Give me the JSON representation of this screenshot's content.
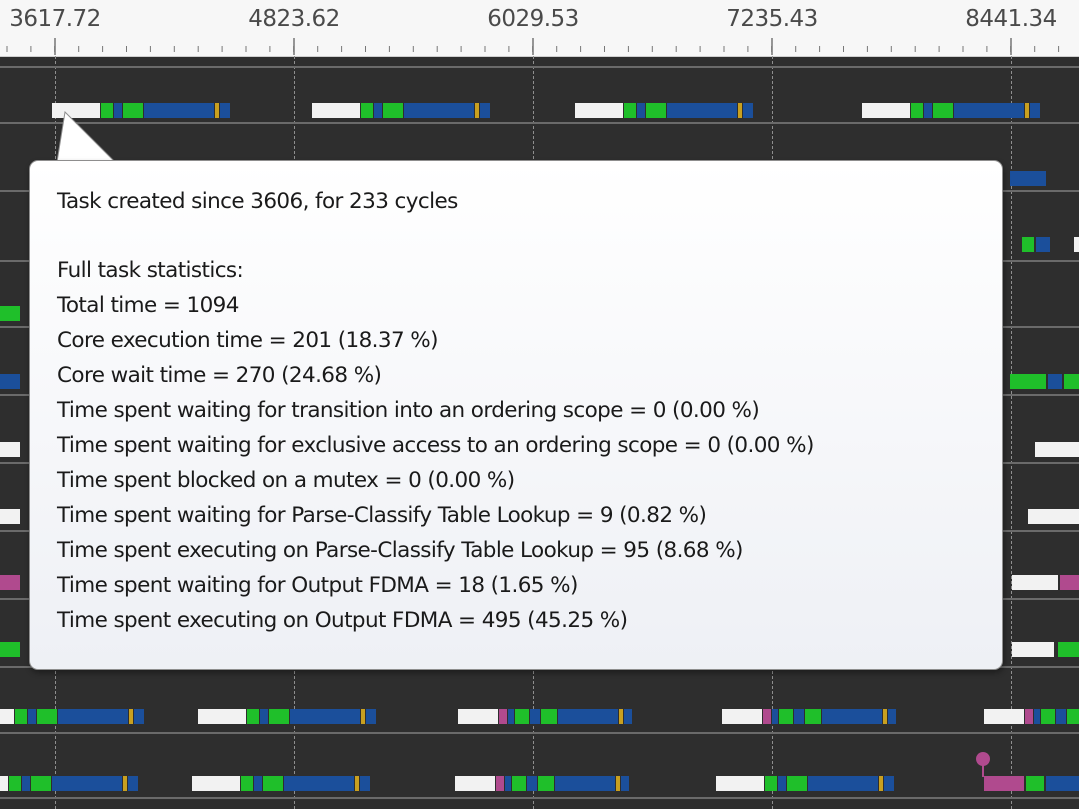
{
  "ruler": {
    "labels": [
      "3617.72",
      "4823.62",
      "6029.53",
      "7235.43",
      "8441.34"
    ]
  },
  "colors": {
    "background": "#2e2e2e",
    "idle": "#f2f2f2",
    "core": "#1b4f9b",
    "core_wait": "#1fbf2a",
    "pcl": "#b04a8e",
    "fdma": "#c8a020"
  },
  "tooltip": {
    "lines": [
      "Task created since 3606, for 233 cycles",
      "Full task statistics:",
      "Total time = 1094",
      "Core execution time = 201 (18.37 %)",
      "Core wait time = 270 (24.68 %)",
      "Time spent waiting for transition into an ordering scope = 0 (0.00 %)",
      "Time spent waiting for exclusive access to an ordering scope = 0 (0.00 %)",
      "Time spent blocked on a mutex = 0 (0.00 %)",
      "Time spent waiting for Parse-Classify Table Lookup = 9 (0.82 %)",
      "Time spent executing on Parse-Classify Table Lookup = 95 (8.68 %)",
      "Time spent waiting for Output FDMA = 18 (1.65 %)",
      "Time spent executing on Output FDMA = 495 (45.25 %)"
    ]
  }
}
